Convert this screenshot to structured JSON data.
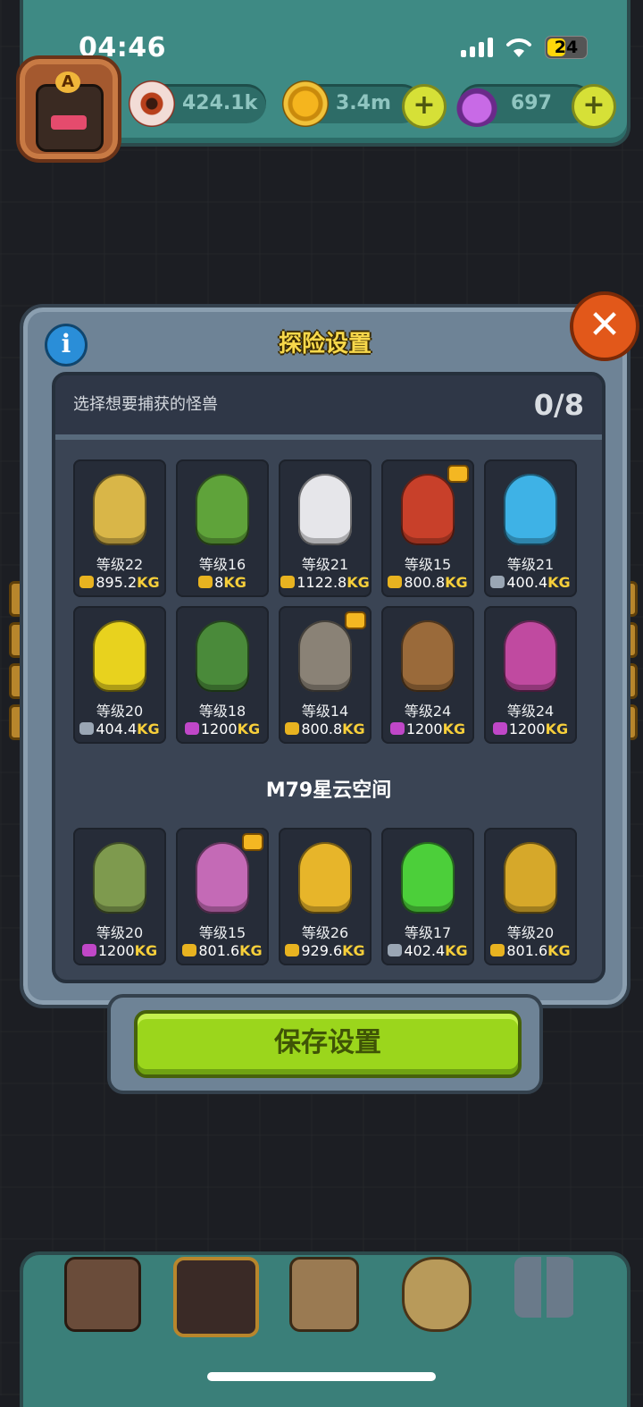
{
  "status_bar": {
    "time": "04:46",
    "battery": "24"
  },
  "resources": [
    {
      "name": "eyeball",
      "value": "424.1k"
    },
    {
      "name": "coin",
      "value": "3.4m"
    },
    {
      "name": "potion",
      "value": "697"
    }
  ],
  "avatar": {
    "letter": "A"
  },
  "panel": {
    "title": "探险设置",
    "prompt": "选择想要捕获的怪兽",
    "count": "0/8",
    "section_title": "M79星云空间"
  },
  "monsters_top": [
    {
      "level": "等级22",
      "weight": "895.2",
      "unit": "KG",
      "color": "#d9b648",
      "bag": "#e8b320",
      "badge": false
    },
    {
      "level": "等级16",
      "weight": "8",
      "unit": "KG",
      "color": "#5fa33a",
      "bag": "#e8b320",
      "badge": false
    },
    {
      "level": "等级21",
      "weight": "1122.8",
      "unit": "KG",
      "color": "#e6e6ea",
      "bag": "#e8b320",
      "badge": false
    },
    {
      "level": "等级15",
      "weight": "800.8",
      "unit": "KG",
      "color": "#c8402a",
      "bag": "#e8b320",
      "badge": true
    },
    {
      "level": "等级21",
      "weight": "400.4",
      "unit": "KG",
      "color": "#3eb2e6",
      "bag": "#9aa6b4",
      "badge": false
    },
    {
      "level": "等级20",
      "weight": "404.4",
      "unit": "KG",
      "color": "#e8d21e",
      "bag": "#9aa6b4",
      "badge": false
    },
    {
      "level": "等级18",
      "weight": "1200",
      "unit": "KG",
      "color": "#4a8a3a",
      "bag": "#c047c8",
      "badge": false
    },
    {
      "level": "等级14",
      "weight": "800.8",
      "unit": "KG",
      "color": "#8a8276",
      "bag": "#e8b320",
      "badge": true
    },
    {
      "level": "等级24",
      "weight": "1200",
      "unit": "KG",
      "color": "#9a6a3a",
      "bag": "#c047c8",
      "badge": false
    },
    {
      "level": "等级24",
      "weight": "1200",
      "unit": "KG",
      "color": "#c04aa0",
      "bag": "#c047c8",
      "badge": false
    }
  ],
  "monsters_bottom": [
    {
      "level": "等级20",
      "weight": "1200",
      "unit": "KG",
      "color": "#7e9a4e",
      "bag": "#c047c8",
      "badge": false
    },
    {
      "level": "等级15",
      "weight": "801.6",
      "unit": "KG",
      "color": "#c46ab6",
      "bag": "#e8b320",
      "badge": true
    },
    {
      "level": "等级26",
      "weight": "929.6",
      "unit": "KG",
      "color": "#e7b52a",
      "bag": "#e8b320",
      "badge": false
    },
    {
      "level": "等级17",
      "weight": "402.4",
      "unit": "KG",
      "color": "#4ccf3a",
      "bag": "#9aa6b4",
      "badge": false
    },
    {
      "level": "等级20",
      "weight": "801.6",
      "unit": "KG",
      "color": "#d6a82a",
      "bag": "#e8b320",
      "badge": false
    }
  ],
  "save_button": {
    "label": "保存设置"
  },
  "colors": {
    "accent_gold": "#f7d84b",
    "save_green": "#9bd61c",
    "close_orange": "#e2581a"
  },
  "nav_icons": [
    "shop-icon",
    "monster-lair-icon",
    "book-icon",
    "money-bag-icon",
    "collection-grid-icon"
  ]
}
